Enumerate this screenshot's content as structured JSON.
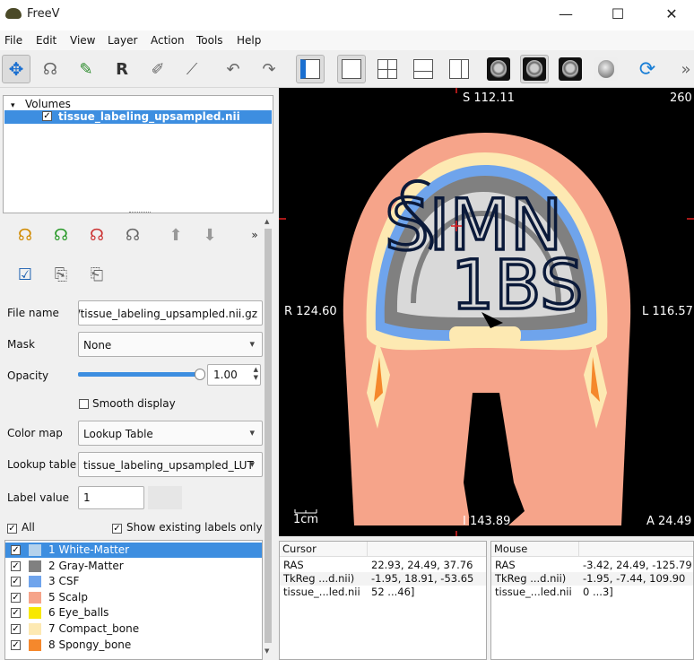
{
  "window": {
    "title": "FreeV",
    "minimize": "—",
    "maximize": "☐",
    "close": "✕"
  },
  "menu": [
    "File",
    "Edit",
    "View",
    "Layer",
    "Action",
    "Tools",
    "Help"
  ],
  "toolbar": {
    "overflow": "»"
  },
  "volumes": {
    "header": "Volumes",
    "item": "tissue_labeling_upsampled.nii"
  },
  "layer_tools": {
    "overflow": "»"
  },
  "props": {
    "file_name_label": "File name",
    "file_name_value": "ep/tissue_labeling_upsampled.nii.gz",
    "mask_label": "Mask",
    "mask_value": "None",
    "opacity_label": "Opacity",
    "opacity_value": "1.00",
    "opacity_level": 1.0,
    "smooth_label": "Smooth display",
    "colormap_label": "Color map",
    "colormap_value": "Lookup Table",
    "lut_label": "Lookup table",
    "lut_value": "tissue_labeling_upsampled_LUT",
    "label_value_label": "Label value",
    "label_value": "1",
    "all_label": "All",
    "show_existing_label": "Show existing labels only"
  },
  "labels": [
    {
      "text": "1 White-Matter",
      "color": "#b4d2ec",
      "selected": true
    },
    {
      "text": "2 Gray-Matter",
      "color": "#808080",
      "selected": false
    },
    {
      "text": "3 CSF",
      "color": "#6fa4ec",
      "selected": false
    },
    {
      "text": "5 Scalp",
      "color": "#f6a48a",
      "selected": false
    },
    {
      "text": "6 Eye_balls",
      "color": "#f8e800",
      "selected": false
    },
    {
      "text": "7 Compact_bone",
      "color": "#fde9b2",
      "selected": false
    },
    {
      "text": "8 Spongy_bone",
      "color": "#f5882c",
      "selected": false
    }
  ],
  "viewport": {
    "top": "S 112.11",
    "top_right": "260",
    "left": "R 124.60",
    "right": "L 116.57",
    "bottom": "I 143.89",
    "bottom_right": "A 24.49",
    "scale": "1cm",
    "overlay_text_1": "SIMN",
    "overlay_text_2": "1BS"
  },
  "cursor_panel": {
    "header": "Cursor",
    "rows": [
      {
        "k": "RAS",
        "v": "22.93, 24.49, 37.76"
      },
      {
        "k": "TkReg ...d.nii)",
        "v": "-1.95, 18.91, -53.65"
      },
      {
        "k": "tissue_...led.nii",
        "v": "52 ...46]"
      }
    ]
  },
  "mouse_panel": {
    "header": "Mouse",
    "rows": [
      {
        "k": "RAS",
        "v": "-3.42, 24.49, -125.79"
      },
      {
        "k": "TkReg ...d.nii)",
        "v": "-1.95, -7.44, 109.90"
      },
      {
        "k": "tissue_...led.nii",
        "v": "0 ...3]"
      }
    ]
  }
}
